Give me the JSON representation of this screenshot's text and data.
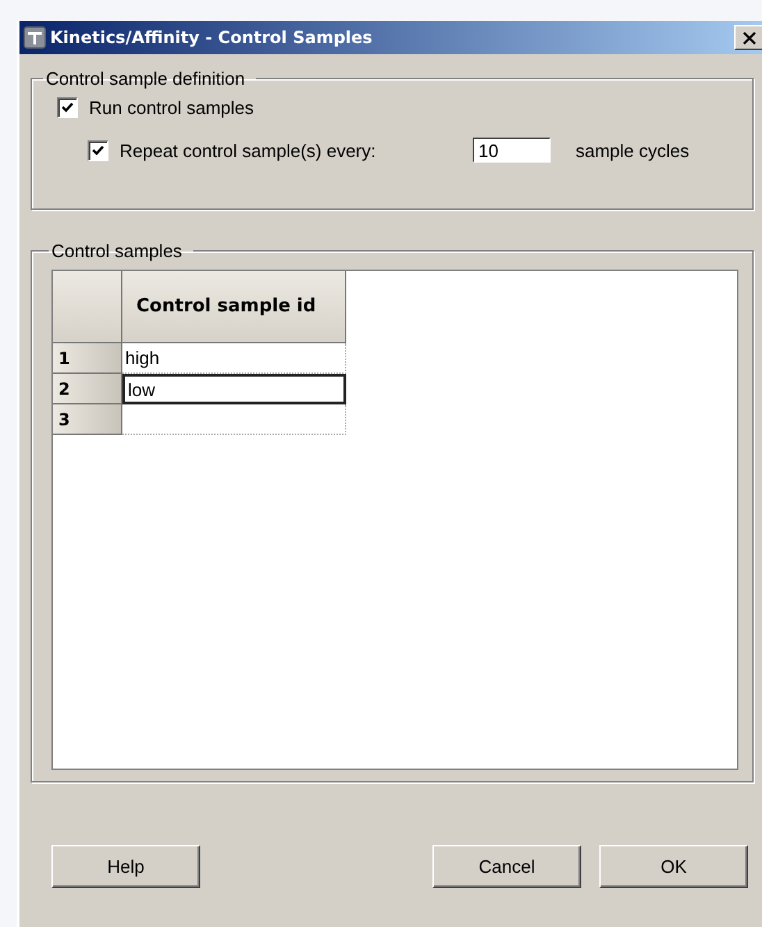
{
  "window": {
    "title": "Kinetics/Affinity - Control Samples"
  },
  "definition": {
    "title": "Control sample definition",
    "run": {
      "label": "Run control samples",
      "checked": true
    },
    "repeat": {
      "label": "Repeat control sample(s) every:",
      "checked": true,
      "value": "10",
      "unit": "sample cycles"
    }
  },
  "samples": {
    "title": "Control samples",
    "columns": [
      "Control sample id"
    ],
    "rows": [
      {
        "number": "1",
        "id": "high",
        "selected": false
      },
      {
        "number": "2",
        "id": "low",
        "selected": true
      },
      {
        "number": "3",
        "id": "",
        "selected": false
      }
    ]
  },
  "buttons": [
    {
      "label": "Help"
    },
    {
      "label": "Cancel"
    },
    {
      "label": "OK"
    }
  ]
}
